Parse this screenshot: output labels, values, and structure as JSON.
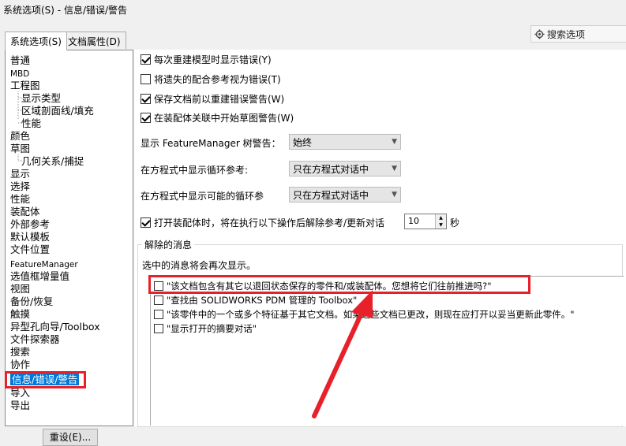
{
  "window": {
    "title": "系统选项(S) - 信息/错误/警告"
  },
  "tabs": [
    {
      "label": "系统选项(S)",
      "active": true
    },
    {
      "label": "文档属性(D)",
      "active": false
    }
  ],
  "search": {
    "placeholder": "搜索选项",
    "icon": "gear-search-icon"
  },
  "tree": {
    "items": [
      {
        "label": "普通"
      },
      {
        "label": "MBD"
      },
      {
        "label": "工程图"
      },
      {
        "label": "显示类型",
        "child": true
      },
      {
        "label": "区域剖面线/填充",
        "child": true
      },
      {
        "label": "性能",
        "child": true
      },
      {
        "label": "颜色"
      },
      {
        "label": "草图"
      },
      {
        "label": "几何关系/捕捉",
        "child": true
      },
      {
        "label": "显示"
      },
      {
        "label": "选择"
      },
      {
        "label": "性能"
      },
      {
        "label": "装配体"
      },
      {
        "label": "外部参考"
      },
      {
        "label": "默认模板"
      },
      {
        "label": "文件位置"
      },
      {
        "label": "FeatureManager"
      },
      {
        "label": "选值框增量值"
      },
      {
        "label": "视图"
      },
      {
        "label": "备份/恢复"
      },
      {
        "label": "触摸"
      },
      {
        "label": "异型孔向导/Toolbox"
      },
      {
        "label": "文件探索器"
      },
      {
        "label": "搜索"
      },
      {
        "label": "协作"
      },
      {
        "label": "信息/错误/警告",
        "selected": true
      },
      {
        "label": "导入"
      },
      {
        "label": "导出"
      }
    ]
  },
  "options": {
    "cb1": {
      "label": "每次重建模型时显示错误(Y)",
      "checked": true
    },
    "cb2": {
      "label": "将遗失的配合参考视为错误(T)",
      "checked": false
    },
    "cb3": {
      "label": "保存文档前以重建错误警告(W)",
      "checked": true
    },
    "cb4": {
      "label": "在装配体关联中开始草图警告(W)",
      "checked": true
    },
    "fm_warning_label": "显示 FeatureManager 树警告：",
    "fm_warning_value": "始终",
    "loop_ref_label": "在方程式中显示循环参考:",
    "loop_ref_value": "只在方程式对话中",
    "possible_loop_label": "在方程式中显示可能的循环参",
    "possible_loop_value": "只在方程式对话中",
    "open_assembly_label": "打开装配体时，将在执行以下操作后解除参考/更新对话",
    "open_assembly_checked": true,
    "seconds_value": "10",
    "seconds_unit": "秒"
  },
  "dismissed": {
    "title": "解除的消息",
    "hint": "选中的消息将会再次显示。",
    "messages": [
      {
        "label": "\"该文档包含有其它以退回状态保存的零件和/或装配体。您想将它们往前推进吗?\"",
        "checked": false
      },
      {
        "label": "\"查找由 SOLIDWORKS PDM 管理的 Toolbox\"",
        "checked": false
      },
      {
        "label": "\"该零件中的一个或多个特征基于其它文档。如果这些文档已更改，则现在应打开以妥当更新此零件。\"",
        "checked": false
      },
      {
        "label": "\"显示打开的摘要对话\"",
        "checked": false
      }
    ]
  },
  "footer": {
    "reset_label": "重设(E)..."
  },
  "colors": {
    "highlight": "#e8202a",
    "selection": "#0078d7"
  }
}
